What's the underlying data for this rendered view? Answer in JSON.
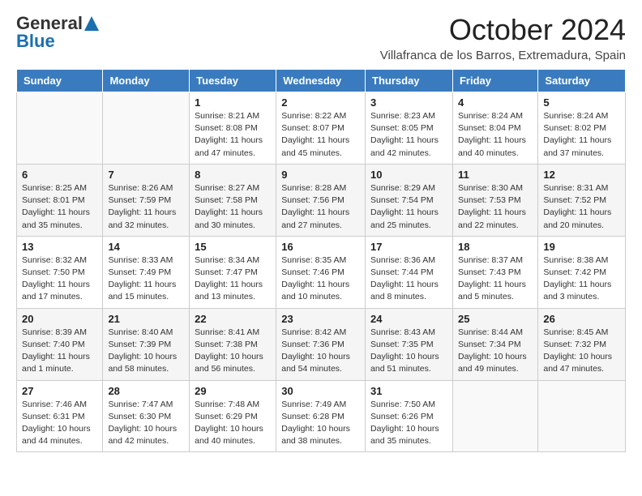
{
  "logo": {
    "line1": "General",
    "line2": "Blue"
  },
  "title": "October 2024",
  "subtitle": "Villafranca de los Barros, Extremadura, Spain",
  "days_of_week": [
    "Sunday",
    "Monday",
    "Tuesday",
    "Wednesday",
    "Thursday",
    "Friday",
    "Saturday"
  ],
  "weeks": [
    [
      {
        "day": "",
        "info": ""
      },
      {
        "day": "",
        "info": ""
      },
      {
        "day": "1",
        "info": "Sunrise: 8:21 AM\nSunset: 8:08 PM\nDaylight: 11 hours and 47 minutes."
      },
      {
        "day": "2",
        "info": "Sunrise: 8:22 AM\nSunset: 8:07 PM\nDaylight: 11 hours and 45 minutes."
      },
      {
        "day": "3",
        "info": "Sunrise: 8:23 AM\nSunset: 8:05 PM\nDaylight: 11 hours and 42 minutes."
      },
      {
        "day": "4",
        "info": "Sunrise: 8:24 AM\nSunset: 8:04 PM\nDaylight: 11 hours and 40 minutes."
      },
      {
        "day": "5",
        "info": "Sunrise: 8:24 AM\nSunset: 8:02 PM\nDaylight: 11 hours and 37 minutes."
      }
    ],
    [
      {
        "day": "6",
        "info": "Sunrise: 8:25 AM\nSunset: 8:01 PM\nDaylight: 11 hours and 35 minutes."
      },
      {
        "day": "7",
        "info": "Sunrise: 8:26 AM\nSunset: 7:59 PM\nDaylight: 11 hours and 32 minutes."
      },
      {
        "day": "8",
        "info": "Sunrise: 8:27 AM\nSunset: 7:58 PM\nDaylight: 11 hours and 30 minutes."
      },
      {
        "day": "9",
        "info": "Sunrise: 8:28 AM\nSunset: 7:56 PM\nDaylight: 11 hours and 27 minutes."
      },
      {
        "day": "10",
        "info": "Sunrise: 8:29 AM\nSunset: 7:54 PM\nDaylight: 11 hours and 25 minutes."
      },
      {
        "day": "11",
        "info": "Sunrise: 8:30 AM\nSunset: 7:53 PM\nDaylight: 11 hours and 22 minutes."
      },
      {
        "day": "12",
        "info": "Sunrise: 8:31 AM\nSunset: 7:52 PM\nDaylight: 11 hours and 20 minutes."
      }
    ],
    [
      {
        "day": "13",
        "info": "Sunrise: 8:32 AM\nSunset: 7:50 PM\nDaylight: 11 hours and 17 minutes."
      },
      {
        "day": "14",
        "info": "Sunrise: 8:33 AM\nSunset: 7:49 PM\nDaylight: 11 hours and 15 minutes."
      },
      {
        "day": "15",
        "info": "Sunrise: 8:34 AM\nSunset: 7:47 PM\nDaylight: 11 hours and 13 minutes."
      },
      {
        "day": "16",
        "info": "Sunrise: 8:35 AM\nSunset: 7:46 PM\nDaylight: 11 hours and 10 minutes."
      },
      {
        "day": "17",
        "info": "Sunrise: 8:36 AM\nSunset: 7:44 PM\nDaylight: 11 hours and 8 minutes."
      },
      {
        "day": "18",
        "info": "Sunrise: 8:37 AM\nSunset: 7:43 PM\nDaylight: 11 hours and 5 minutes."
      },
      {
        "day": "19",
        "info": "Sunrise: 8:38 AM\nSunset: 7:42 PM\nDaylight: 11 hours and 3 minutes."
      }
    ],
    [
      {
        "day": "20",
        "info": "Sunrise: 8:39 AM\nSunset: 7:40 PM\nDaylight: 11 hours and 1 minute."
      },
      {
        "day": "21",
        "info": "Sunrise: 8:40 AM\nSunset: 7:39 PM\nDaylight: 10 hours and 58 minutes."
      },
      {
        "day": "22",
        "info": "Sunrise: 8:41 AM\nSunset: 7:38 PM\nDaylight: 10 hours and 56 minutes."
      },
      {
        "day": "23",
        "info": "Sunrise: 8:42 AM\nSunset: 7:36 PM\nDaylight: 10 hours and 54 minutes."
      },
      {
        "day": "24",
        "info": "Sunrise: 8:43 AM\nSunset: 7:35 PM\nDaylight: 10 hours and 51 minutes."
      },
      {
        "day": "25",
        "info": "Sunrise: 8:44 AM\nSunset: 7:34 PM\nDaylight: 10 hours and 49 minutes."
      },
      {
        "day": "26",
        "info": "Sunrise: 8:45 AM\nSunset: 7:32 PM\nDaylight: 10 hours and 47 minutes."
      }
    ],
    [
      {
        "day": "27",
        "info": "Sunrise: 7:46 AM\nSunset: 6:31 PM\nDaylight: 10 hours and 44 minutes."
      },
      {
        "day": "28",
        "info": "Sunrise: 7:47 AM\nSunset: 6:30 PM\nDaylight: 10 hours and 42 minutes."
      },
      {
        "day": "29",
        "info": "Sunrise: 7:48 AM\nSunset: 6:29 PM\nDaylight: 10 hours and 40 minutes."
      },
      {
        "day": "30",
        "info": "Sunrise: 7:49 AM\nSunset: 6:28 PM\nDaylight: 10 hours and 38 minutes."
      },
      {
        "day": "31",
        "info": "Sunrise: 7:50 AM\nSunset: 6:26 PM\nDaylight: 10 hours and 35 minutes."
      },
      {
        "day": "",
        "info": ""
      },
      {
        "day": "",
        "info": ""
      }
    ]
  ]
}
